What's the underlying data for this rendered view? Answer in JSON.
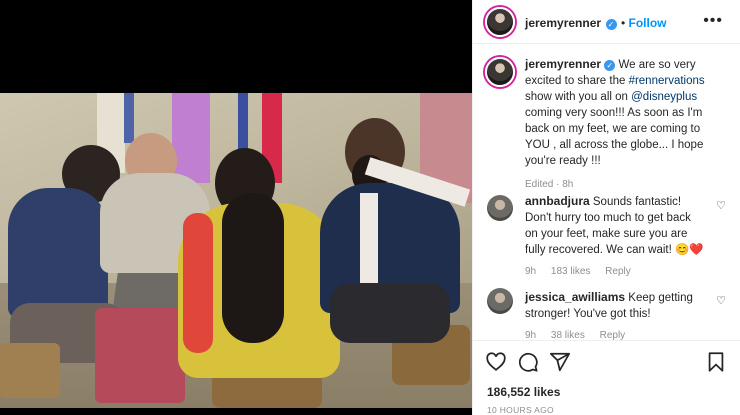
{
  "post": {
    "username": "jeremyrenner",
    "follow_label": "Follow",
    "more_label": "•••",
    "caption_prefix": "We are so very excited to share the ",
    "hashtag": "#rennervations",
    "caption_mid": " show with you all on ",
    "mention": "@disneyplus",
    "caption_suffix": " coming very soon!!! As soon as I'm back on my feet, we are coming to YOU , all across the globe... I hope you're ready !!!",
    "edited_label": "Edited · 8h"
  },
  "comments": [
    {
      "username": "annbadjura",
      "text": "Sounds fantastic! Don't hurry too much to get back on your feet, make sure you are fully recovered. We can wait! 😊❤️",
      "time": "9h",
      "likes": "183 likes",
      "reply": "Reply"
    },
    {
      "username": "jessica_awilliams",
      "text": "Keep getting stronger! You've got this!",
      "time": "9h",
      "likes": "38 likes",
      "reply": "Reply"
    }
  ],
  "footer": {
    "likes": "186,552 likes",
    "timestamp": "10 HOURS AGO"
  },
  "icons": {
    "like": "heart-icon",
    "comment": "comment-icon",
    "share": "share-icon",
    "save": "bookmark-icon"
  },
  "colors": {
    "accent": "#0095f6",
    "verified": "#3897f0",
    "muted": "#8e8e8e"
  }
}
